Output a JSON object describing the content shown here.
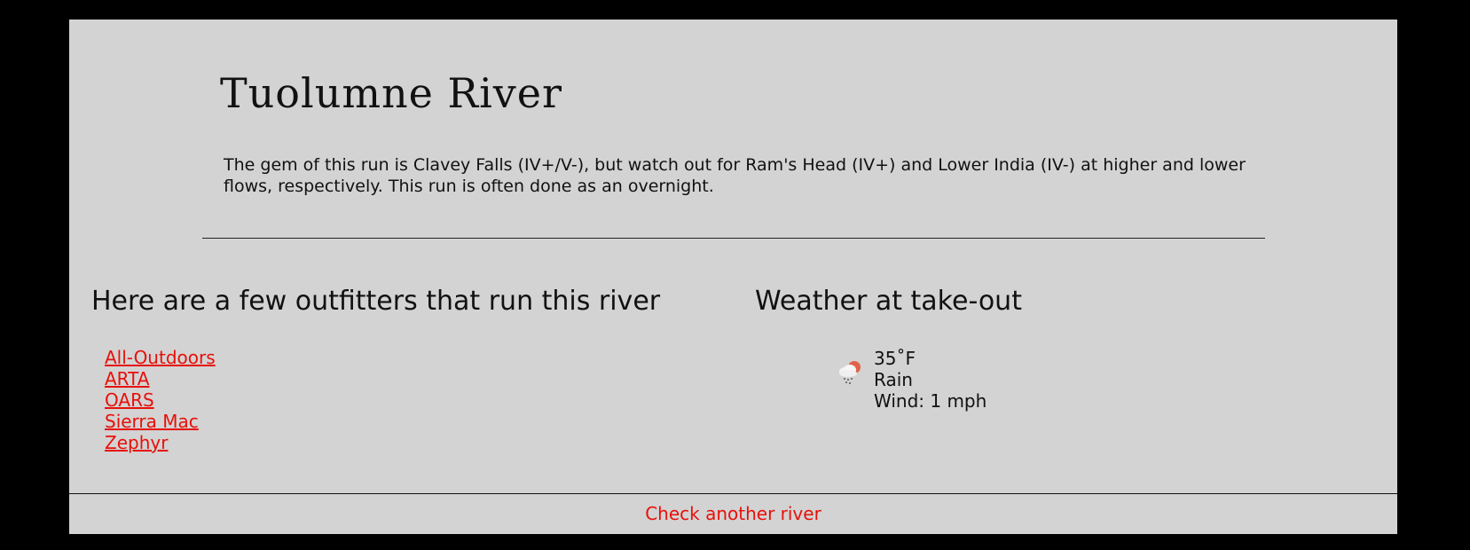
{
  "river": {
    "title": "Tuolumne River",
    "description": "The gem of this run is Clavey Falls (IV+/V-), but watch out for Ram's Head (IV+) and Lower India (IV-) at higher and lower flows, respectively. This run is often done as an overnight."
  },
  "outfitters": {
    "heading": "Here are a few outfitters that run this river",
    "items": [
      {
        "label": "All-Outdoors"
      },
      {
        "label": "ARTA"
      },
      {
        "label": "OARS"
      },
      {
        "label": "Sierra Mac"
      },
      {
        "label": "Zephyr"
      }
    ]
  },
  "weather": {
    "heading": "Weather at take-out",
    "icon": "rain-cloud-sun-icon",
    "temperature": "35˚F",
    "condition": "Rain",
    "wind": "Wind: 1 mph"
  },
  "footer": {
    "link_label": "Check another river"
  },
  "colors": {
    "page_background": "#d3d3d3",
    "outer_background": "#000000",
    "link": "#e8100a"
  }
}
